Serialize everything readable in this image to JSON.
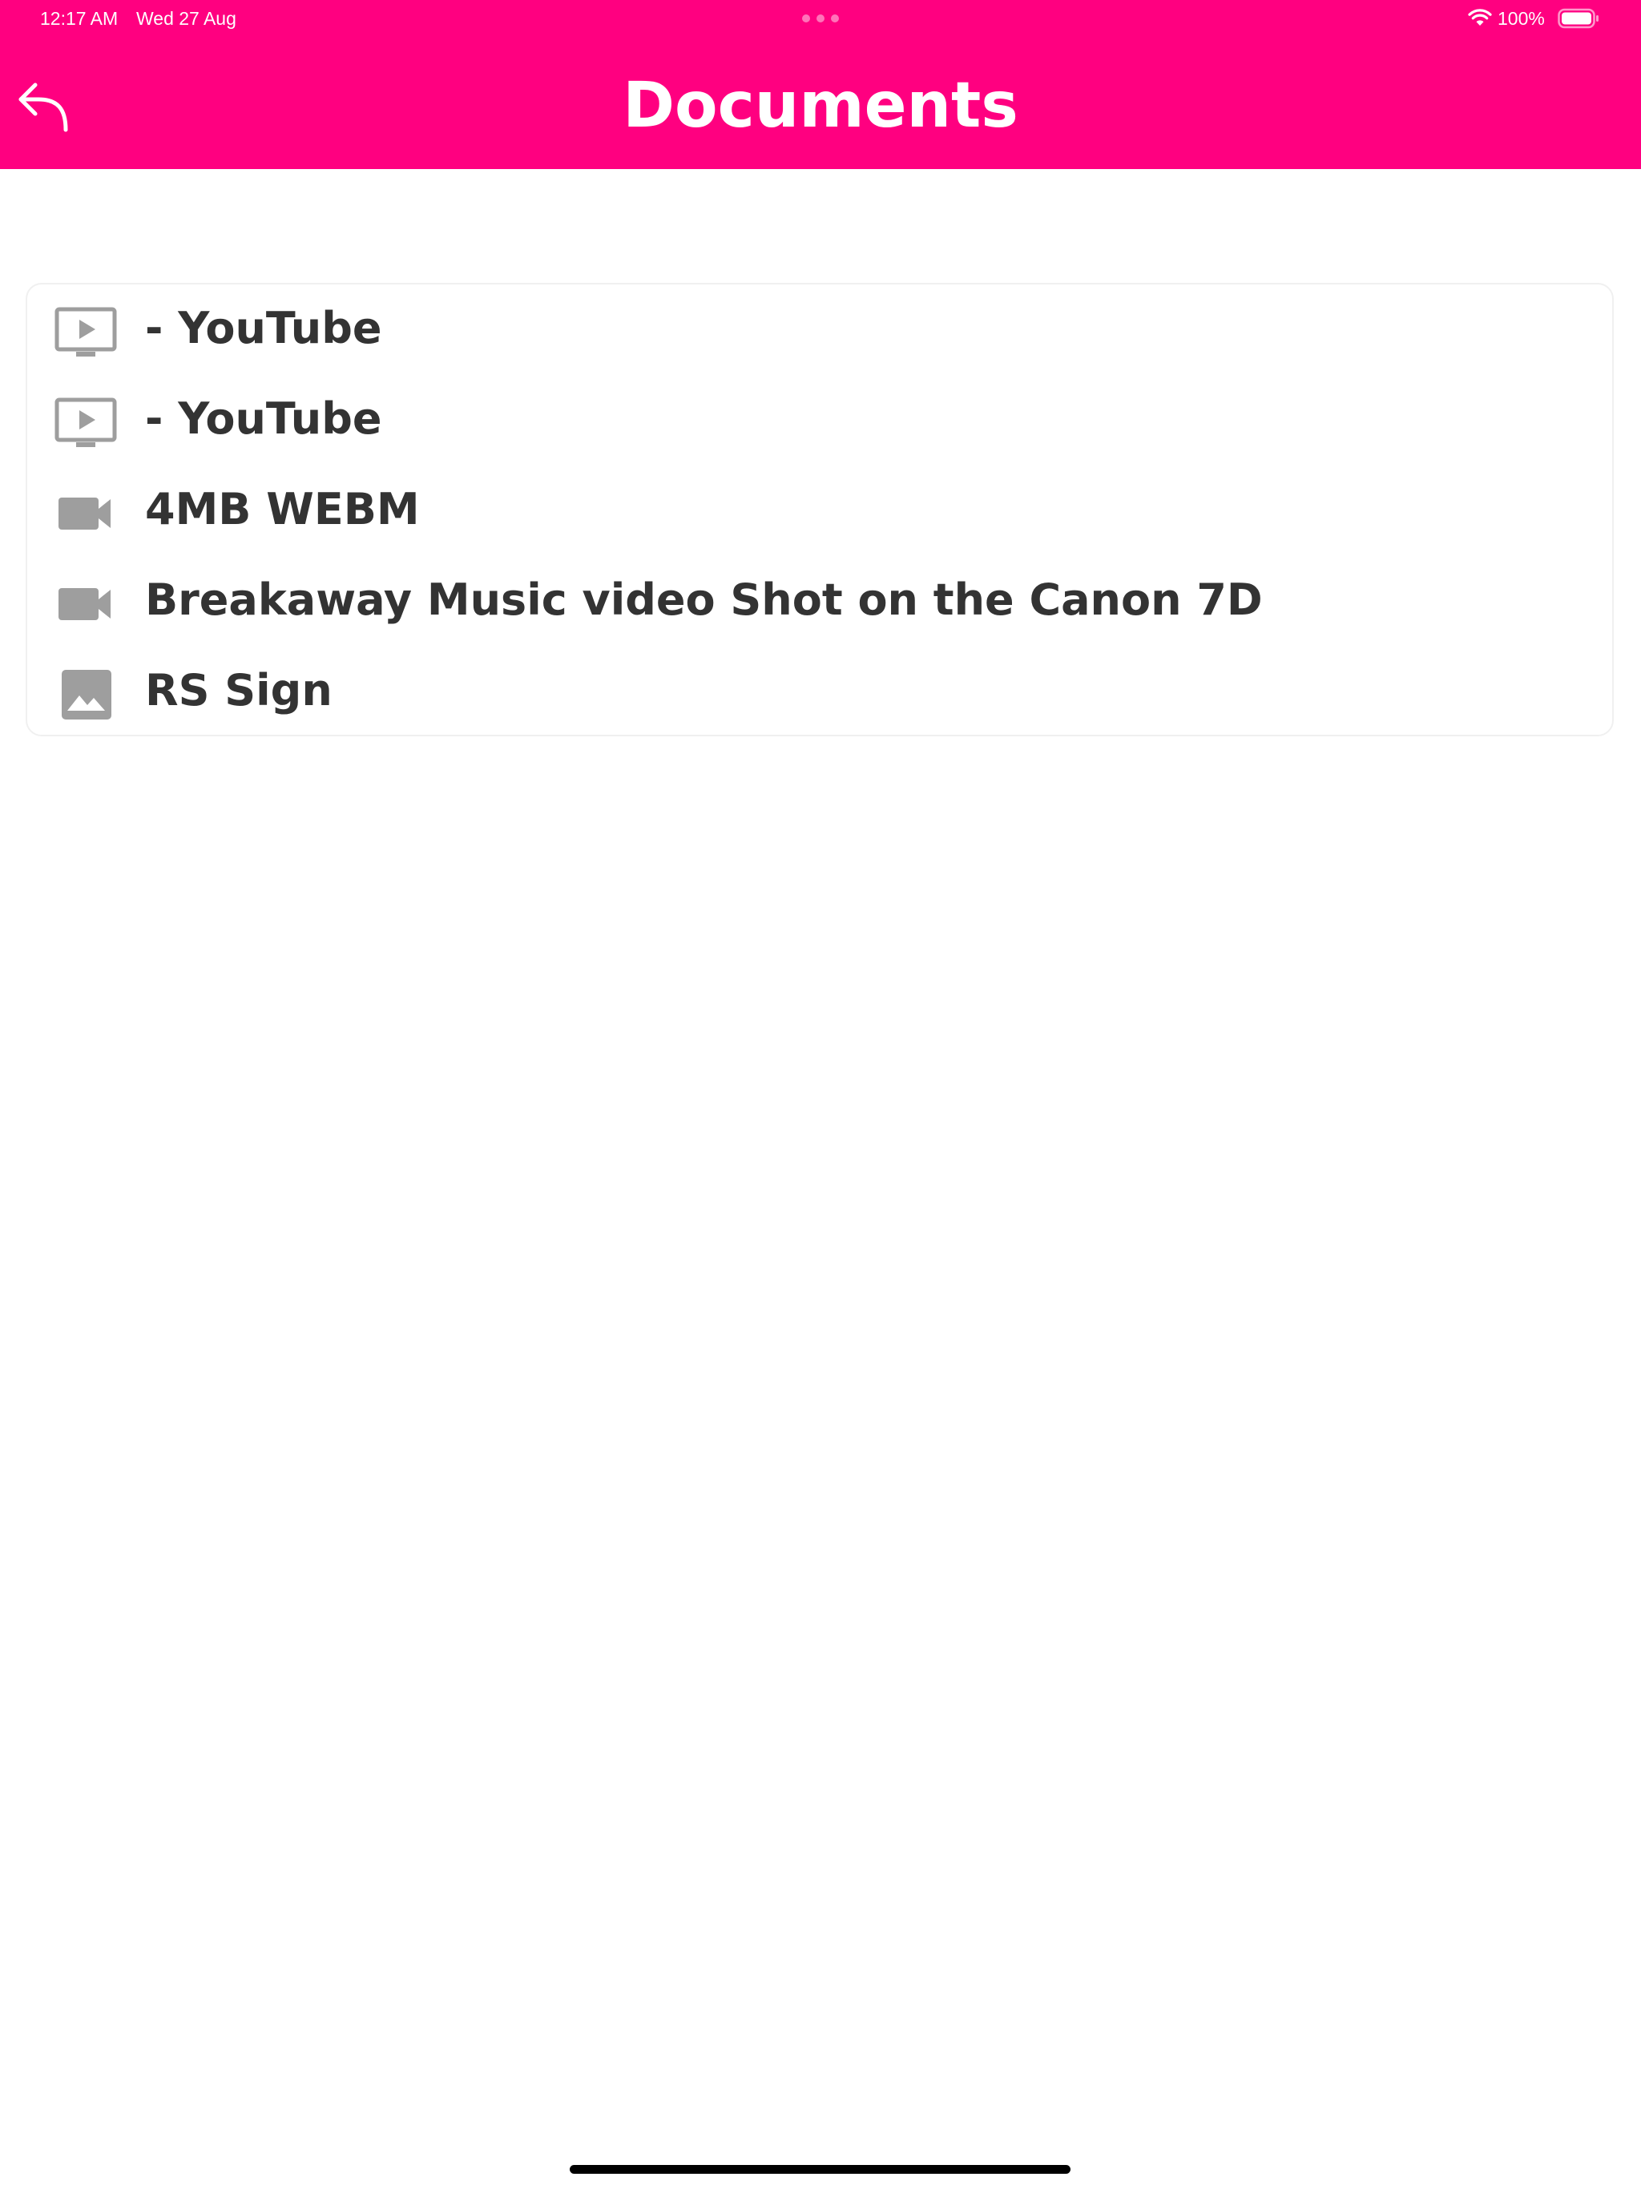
{
  "colors": {
    "header_bg": "#ff0080",
    "header_text": "#ffffff",
    "item_text": "#333333",
    "icon_gray": "#9e9e9e",
    "card_border": "#f0f0f0"
  },
  "status_bar": {
    "time": "12:17 AM",
    "date": "Wed 27 Aug",
    "battery": "100%",
    "icons": [
      "wifi-icon",
      "battery-icon"
    ]
  },
  "header": {
    "title": "Documents",
    "back_icon": "back-arrow-icon"
  },
  "documents": [
    {
      "label": "- YouTube",
      "icon": "tv-play-icon"
    },
    {
      "label": "- YouTube",
      "icon": "tv-play-icon"
    },
    {
      "label": "4MB WEBM",
      "icon": "video-camera-icon"
    },
    {
      "label": "Breakaway Music video Shot on the Canon 7D",
      "icon": "video-camera-icon"
    },
    {
      "label": "RS Sign",
      "icon": "image-icon"
    }
  ]
}
